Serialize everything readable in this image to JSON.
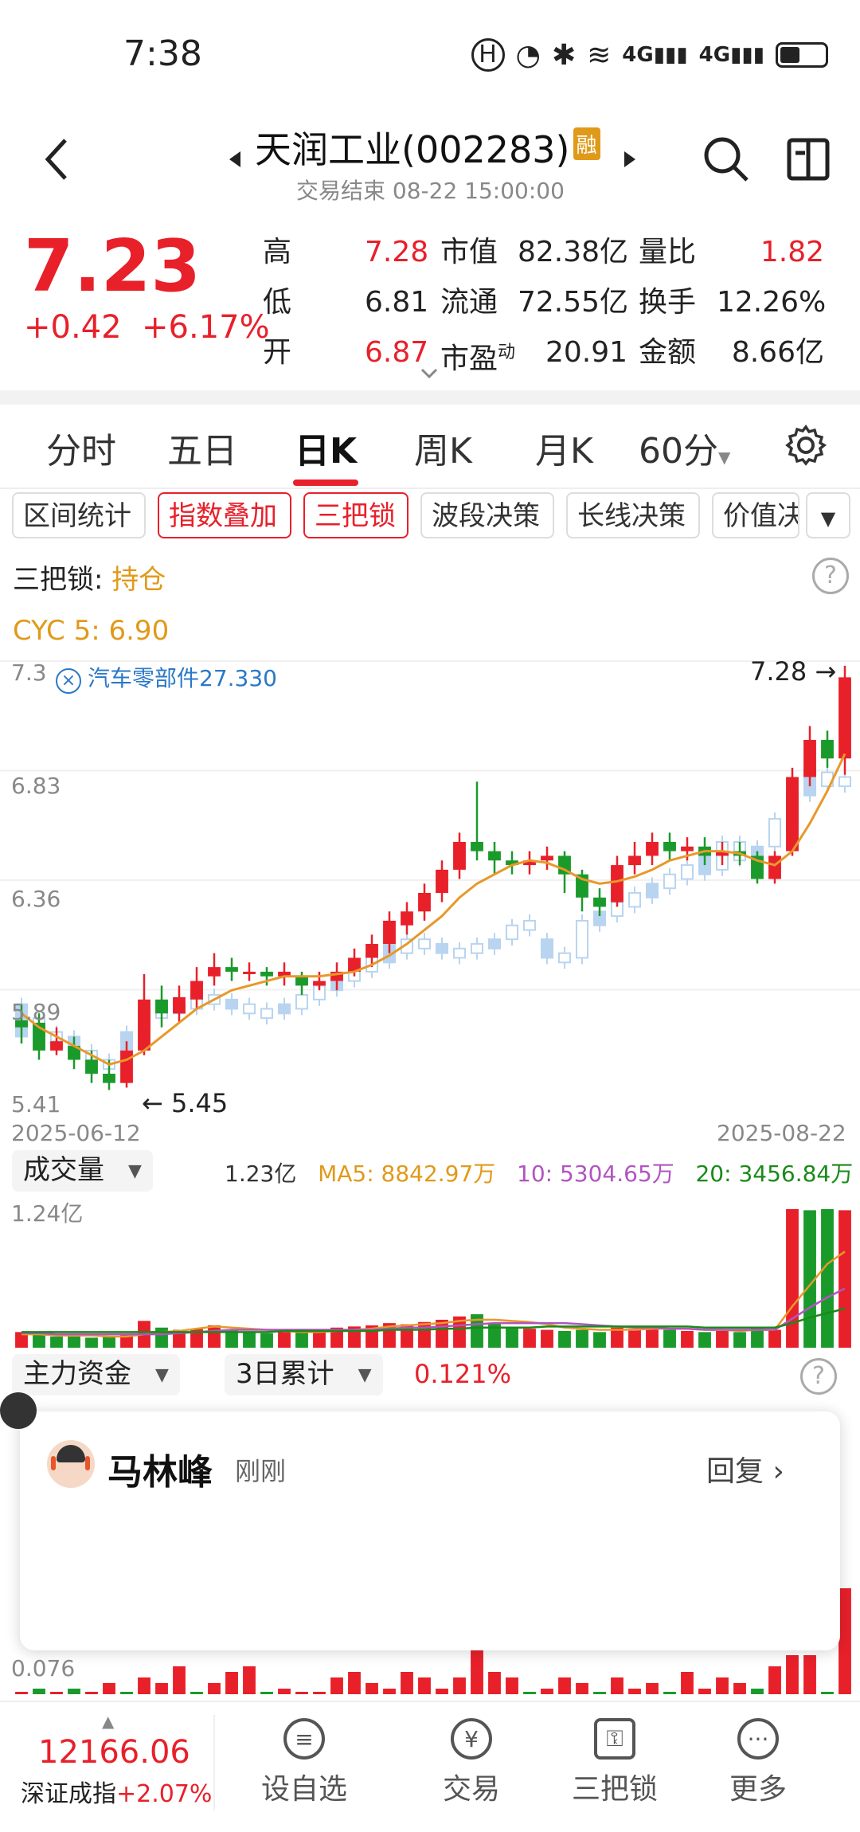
{
  "status": {
    "time": "7:38"
  },
  "header": {
    "title": "天润工业(002283)",
    "rong_badge": "融",
    "subtitle": "交易结束 08-22 15:00:00"
  },
  "quote": {
    "price": "7.23",
    "change": "+0.42",
    "change_pct": "+6.17%",
    "rows": [
      [
        {
          "label": "高",
          "value": "7.28",
          "color": "#e8202a"
        },
        {
          "label": "市值",
          "value": "82.38亿",
          "color": "#222"
        },
        {
          "label": "量比",
          "value": "1.82",
          "color": "#e8202a"
        }
      ],
      [
        {
          "label": "低",
          "value": "6.81",
          "color": "#222"
        },
        {
          "label": "流通",
          "value": "72.55亿",
          "color": "#222"
        },
        {
          "label": "换手",
          "value": "12.26%",
          "color": "#222"
        }
      ],
      [
        {
          "label": "开",
          "value": "6.87",
          "color": "#e8202a"
        },
        {
          "label": "市盈动",
          "value": "20.91",
          "color": "#222"
        },
        {
          "label": "金额",
          "value": "8.66亿",
          "color": "#222"
        }
      ]
    ]
  },
  "tabs": [
    "分时",
    "五日",
    "日K",
    "周K",
    "月K",
    "60分"
  ],
  "active_tab": "日K",
  "chips": [
    "区间统计",
    "指数叠加",
    "三把锁",
    "波段决策",
    "长线决策",
    "价值决"
  ],
  "indicator": {
    "sanbasuo_label": "三把锁:",
    "sanbasuo_value": "持仓",
    "cyc_label": "CYC 5: 6.90"
  },
  "kchart": {
    "y_ticks": [
      "7.3",
      "6.83",
      "6.36",
      "5.89",
      "5.41"
    ],
    "overlay_label": "汽车零部件27.330",
    "high_marker": "7.28",
    "low_marker": "5.45",
    "date_start": "2025-06-12",
    "date_end": "2025-08-22"
  },
  "chart_data": [
    {
      "type": "candlestick",
      "title": "",
      "ylim": [
        5.41,
        7.3
      ],
      "candles": [
        [
          5.75,
          5.72,
          5.82,
          5.65
        ],
        [
          5.74,
          5.62,
          5.78,
          5.58
        ],
        [
          5.62,
          5.66,
          5.72,
          5.6
        ],
        [
          5.64,
          5.58,
          5.68,
          5.54
        ],
        [
          5.58,
          5.52,
          5.62,
          5.48
        ],
        [
          5.52,
          5.48,
          5.58,
          5.45
        ],
        [
          5.48,
          5.62,
          5.66,
          5.46
        ],
        [
          5.62,
          5.84,
          5.95,
          5.6
        ],
        [
          5.84,
          5.78,
          5.9,
          5.72
        ],
        [
          5.78,
          5.85,
          5.9,
          5.74
        ],
        [
          5.84,
          5.92,
          5.98,
          5.8
        ],
        [
          5.94,
          5.98,
          6.04,
          5.9
        ],
        [
          5.98,
          5.96,
          6.02,
          5.92
        ],
        [
          5.96,
          5.96,
          6.0,
          5.92
        ],
        [
          5.96,
          5.94,
          5.98,
          5.9
        ],
        [
          5.94,
          5.96,
          6.0,
          5.9
        ],
        [
          5.94,
          5.9,
          5.96,
          5.86
        ],
        [
          5.9,
          5.92,
          5.96,
          5.88
        ],
        [
          5.92,
          5.96,
          6.0,
          5.88
        ],
        [
          5.96,
          6.02,
          6.06,
          5.94
        ],
        [
          6.02,
          6.08,
          6.12,
          5.98
        ],
        [
          6.08,
          6.18,
          6.22,
          6.04
        ],
        [
          6.16,
          6.22,
          6.26,
          6.12
        ],
        [
          6.22,
          6.3,
          6.34,
          6.18
        ],
        [
          6.3,
          6.4,
          6.44,
          6.26
        ],
        [
          6.4,
          6.52,
          6.56,
          6.36
        ],
        [
          6.52,
          6.48,
          6.78,
          6.44
        ],
        [
          6.48,
          6.44,
          6.52,
          6.38
        ],
        [
          6.44,
          6.42,
          6.48,
          6.38
        ],
        [
          6.42,
          6.44,
          6.48,
          6.38
        ],
        [
          6.44,
          6.46,
          6.5,
          6.4
        ],
        [
          6.46,
          6.38,
          6.48,
          6.3
        ],
        [
          6.38,
          6.28,
          6.4,
          6.22
        ],
        [
          6.28,
          6.24,
          6.32,
          6.2
        ],
        [
          6.26,
          6.42,
          6.46,
          6.24
        ],
        [
          6.42,
          6.46,
          6.52,
          6.38
        ],
        [
          6.46,
          6.52,
          6.56,
          6.42
        ],
        [
          6.52,
          6.48,
          6.56,
          6.44
        ],
        [
          6.48,
          6.5,
          6.54,
          6.44
        ],
        [
          6.5,
          6.46,
          6.54,
          6.42
        ],
        [
          6.46,
          6.48,
          6.52,
          6.42
        ],
        [
          6.48,
          6.46,
          6.52,
          6.42
        ],
        [
          6.46,
          6.36,
          6.48,
          6.34
        ],
        [
          6.36,
          6.46,
          6.48,
          6.34
        ],
        [
          6.48,
          6.8,
          6.84,
          6.46
        ],
        [
          6.8,
          6.96,
          7.02,
          6.76
        ],
        [
          6.96,
          6.88,
          7.0,
          6.84
        ],
        [
          6.88,
          7.23,
          7.28,
          6.81
        ]
      ],
      "overlay_candles": [
        [
          5.68,
          5.82
        ],
        [
          5.66,
          5.76
        ],
        [
          5.66,
          5.7
        ],
        [
          5.62,
          5.68
        ],
        [
          5.58,
          5.62
        ],
        [
          5.54,
          5.58
        ],
        [
          5.6,
          5.7
        ],
        [
          5.72,
          5.8
        ],
        [
          5.76,
          5.82
        ],
        [
          5.78,
          5.82
        ],
        [
          5.8,
          5.86
        ],
        [
          5.82,
          5.86
        ],
        [
          5.8,
          5.84
        ],
        [
          5.78,
          5.82
        ],
        [
          5.76,
          5.8
        ],
        [
          5.78,
          5.82
        ],
        [
          5.8,
          5.86
        ],
        [
          5.84,
          5.9
        ],
        [
          5.88,
          5.94
        ],
        [
          5.92,
          5.98
        ],
        [
          5.96,
          6.04
        ],
        [
          6.0,
          6.08
        ],
        [
          6.04,
          6.1
        ],
        [
          6.06,
          6.1
        ],
        [
          6.04,
          6.08
        ],
        [
          6.02,
          6.06
        ],
        [
          6.04,
          6.08
        ],
        [
          6.06,
          6.1
        ],
        [
          6.1,
          6.16
        ],
        [
          6.14,
          6.18
        ],
        [
          6.02,
          6.1
        ],
        [
          6.0,
          6.04
        ],
        [
          6.02,
          6.18
        ],
        [
          6.16,
          6.22
        ],
        [
          6.2,
          6.26
        ],
        [
          6.24,
          6.3
        ],
        [
          6.28,
          6.34
        ],
        [
          6.32,
          6.38
        ],
        [
          6.36,
          6.42
        ],
        [
          6.38,
          6.48
        ],
        [
          6.4,
          6.52
        ],
        [
          6.44,
          6.52
        ],
        [
          6.42,
          6.5
        ],
        [
          6.5,
          6.62
        ],
        [
          6.58,
          6.74
        ],
        [
          6.72,
          6.84
        ],
        [
          6.76,
          6.82
        ],
        [
          6.76,
          6.8
        ]
      ],
      "ma5": [
        5.78,
        5.72,
        5.68,
        5.64,
        5.6,
        5.56,
        5.58,
        5.62,
        5.68,
        5.74,
        5.8,
        5.84,
        5.88,
        5.9,
        5.92,
        5.94,
        5.94,
        5.94,
        5.95,
        5.96,
        5.99,
        6.03,
        6.08,
        6.14,
        6.2,
        6.28,
        6.34,
        6.38,
        6.42,
        6.44,
        6.43,
        6.4,
        6.36,
        6.34,
        6.35,
        6.37,
        6.4,
        6.44,
        6.46,
        6.48,
        6.48,
        6.47,
        6.44,
        6.42,
        6.48,
        6.6,
        6.74,
        6.9
      ]
    },
    {
      "type": "bar",
      "title": "成交量",
      "ymax_label": "1.24亿",
      "unit": "亿",
      "ylim": [
        0,
        1.24
      ],
      "values": [
        0.14,
        0.12,
        0.1,
        0.1,
        0.09,
        0.1,
        0.12,
        0.24,
        0.18,
        0.16,
        0.17,
        0.2,
        0.16,
        0.14,
        0.13,
        0.14,
        0.15,
        0.16,
        0.18,
        0.19,
        0.2,
        0.22,
        0.21,
        0.23,
        0.25,
        0.28,
        0.3,
        0.22,
        0.18,
        0.17,
        0.16,
        0.15,
        0.16,
        0.14,
        0.18,
        0.17,
        0.18,
        0.16,
        0.15,
        0.14,
        0.15,
        0.14,
        0.18,
        0.16,
        1.24,
        1.23,
        1.24,
        1.23
      ],
      "colors": [
        "r",
        "g",
        "g",
        "g",
        "g",
        "g",
        "r",
        "r",
        "g",
        "r",
        "r",
        "r",
        "g",
        "g",
        "g",
        "r",
        "g",
        "r",
        "r",
        "r",
        "r",
        "r",
        "r",
        "r",
        "r",
        "r",
        "g",
        "g",
        "g",
        "r",
        "r",
        "g",
        "g",
        "g",
        "r",
        "r",
        "r",
        "g",
        "r",
        "g",
        "r",
        "g",
        "g",
        "r",
        "r",
        "g",
        "g",
        "r"
      ],
      "ma5": [
        0.12,
        0.12,
        0.11,
        0.11,
        0.11,
        0.1,
        0.1,
        0.12,
        0.14,
        0.15,
        0.17,
        0.19,
        0.18,
        0.17,
        0.16,
        0.15,
        0.14,
        0.14,
        0.15,
        0.16,
        0.17,
        0.19,
        0.2,
        0.21,
        0.22,
        0.24,
        0.25,
        0.25,
        0.24,
        0.23,
        0.21,
        0.18,
        0.17,
        0.16,
        0.16,
        0.16,
        0.17,
        0.17,
        0.17,
        0.16,
        0.16,
        0.15,
        0.16,
        0.16,
        0.37,
        0.56,
        0.75,
        0.86
      ],
      "ma10": [
        0.13,
        0.13,
        0.12,
        0.12,
        0.12,
        0.12,
        0.12,
        0.12,
        0.12,
        0.13,
        0.14,
        0.15,
        0.16,
        0.16,
        0.16,
        0.16,
        0.16,
        0.16,
        0.16,
        0.16,
        0.16,
        0.17,
        0.18,
        0.18,
        0.19,
        0.2,
        0.21,
        0.22,
        0.22,
        0.22,
        0.22,
        0.22,
        0.21,
        0.2,
        0.19,
        0.18,
        0.18,
        0.17,
        0.17,
        0.16,
        0.16,
        0.16,
        0.16,
        0.16,
        0.26,
        0.36,
        0.45,
        0.53
      ],
      "ma20": [
        0.14,
        0.14,
        0.14,
        0.14,
        0.14,
        0.14,
        0.14,
        0.14,
        0.14,
        0.14,
        0.14,
        0.14,
        0.14,
        0.14,
        0.14,
        0.15,
        0.15,
        0.15,
        0.15,
        0.15,
        0.15,
        0.16,
        0.16,
        0.16,
        0.17,
        0.17,
        0.18,
        0.18,
        0.18,
        0.18,
        0.19,
        0.19,
        0.19,
        0.19,
        0.19,
        0.19,
        0.19,
        0.19,
        0.19,
        0.18,
        0.18,
        0.18,
        0.18,
        0.18,
        0.22,
        0.27,
        0.31,
        0.35
      ]
    },
    {
      "type": "bar",
      "title": "主力资金",
      "ylim": [
        0,
        0.2
      ],
      "values": [
        0.0,
        0.01,
        0.0,
        0.01,
        0.0,
        0.02,
        0.0,
        0.03,
        0.02,
        0.05,
        0.0,
        0.02,
        0.04,
        0.05,
        0.0,
        0.01,
        0.0,
        0.0,
        0.03,
        0.04,
        0.02,
        0.01,
        0.04,
        0.03,
        0.01,
        0.03,
        0.09,
        0.04,
        0.03,
        0.0,
        0.01,
        0.03,
        0.02,
        0.0,
        0.03,
        0.01,
        0.02,
        0.0,
        0.04,
        0.01,
        0.03,
        0.02,
        0.01,
        0.05,
        0.07,
        0.07,
        0.0,
        0.19
      ],
      "colors": [
        "r",
        "g",
        "r",
        "g",
        "r",
        "r",
        "g",
        "r",
        "r",
        "r",
        "g",
        "r",
        "r",
        "r",
        "g",
        "r",
        "r",
        "r",
        "r",
        "r",
        "r",
        "r",
        "r",
        "r",
        "r",
        "r",
        "r",
        "r",
        "r",
        "g",
        "r",
        "r",
        "r",
        "g",
        "r",
        "r",
        "r",
        "g",
        "r",
        "r",
        "r",
        "r",
        "g",
        "r",
        "r",
        "r",
        "g",
        "r"
      ]
    }
  ],
  "volume": {
    "label": "成交量",
    "value": "1.23亿",
    "ma5": "MA5: 8842.97万",
    "ma10": "10: 5304.65万",
    "ma20": "20: 3456.84万",
    "ymax": "1.24亿"
  },
  "capital": {
    "label": "主力资金",
    "period": "3日累计",
    "value": "0.121%",
    "tick": "0.076"
  },
  "popup": {
    "name": "马林峰",
    "time": "刚刚",
    "reply": "回复"
  },
  "bottom": {
    "index_value": "12166.06",
    "index_name": "深证成指",
    "index_change": "+2.07%",
    "nav": [
      {
        "label": "设自选",
        "icon": "list-icon"
      },
      {
        "label": "交易",
        "icon": "yuan-icon"
      },
      {
        "label": "三把锁",
        "icon": "lock-icon"
      },
      {
        "label": "更多",
        "icon": "more-icon"
      }
    ]
  },
  "colors": {
    "up": "#e8202a",
    "down": "#1a9a2a",
    "overlay": "#b8d4f0",
    "ma": "#e8982a",
    "ma10": "#b055c0",
    "ma20": "#1a8a1a"
  }
}
